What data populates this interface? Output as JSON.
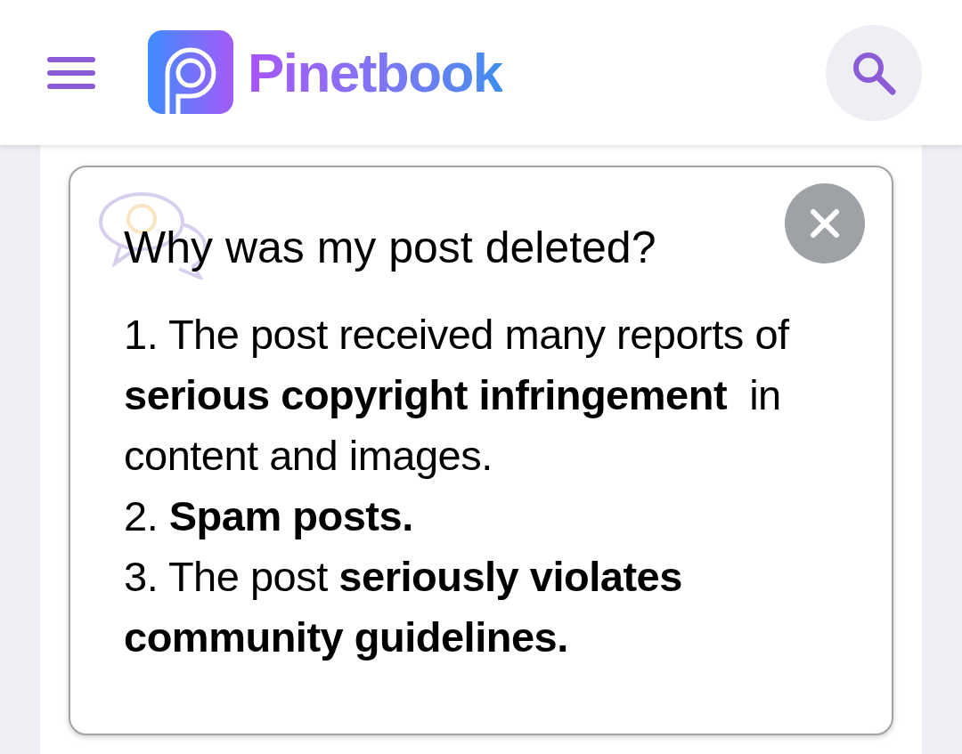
{
  "header": {
    "brand": "Pinetbook"
  },
  "dialog": {
    "title": "Why was my post deleted?",
    "lines": [
      "1. The post received many reports of **serious copyright infringement**  in content and images.",
      "2. **Spam posts.**",
      "3. The post **seriously violates community guidelines.**"
    ]
  }
}
